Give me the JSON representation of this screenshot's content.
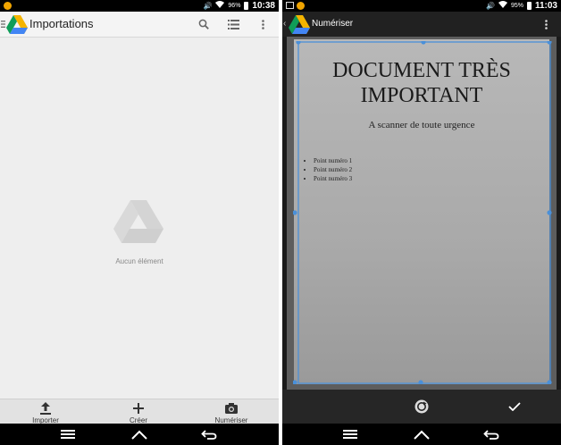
{
  "left_screen": {
    "status_bar": {
      "battery_percent": "96%",
      "time": "10:38"
    },
    "app_bar": {
      "title": "Importations",
      "icons": [
        "menu-icon",
        "google-drive-logo",
        "search-icon",
        "list-view-icon",
        "overflow-menu-icon"
      ]
    },
    "empty_state": {
      "text": "Aucun élément"
    },
    "bottom_actions": [
      {
        "label": "Importer",
        "icon": "upload-icon"
      },
      {
        "label": "Créer",
        "icon": "plus-icon"
      },
      {
        "label": "Numériser",
        "icon": "camera-icon"
      }
    ],
    "nav_bar": [
      "menu-nav-icon",
      "home-nav-icon",
      "back-nav-icon"
    ]
  },
  "right_screen": {
    "status_bar": {
      "battery_percent": "95%",
      "time": "11:03"
    },
    "app_bar": {
      "title": "Numériser",
      "icons": [
        "back-chevron-icon",
        "google-drive-logo",
        "overflow-menu-icon"
      ]
    },
    "document": {
      "title_line1": "DOCUMENT TRÈS",
      "title_line2": "IMPORTANT",
      "subtitle": "A scanner de toute urgence",
      "list": [
        "Point numéro 1",
        "Point numéro 2",
        "Point numéro 3"
      ]
    },
    "bottom_actions": [
      {
        "name": "retake",
        "icon": "retake-icon"
      },
      {
        "name": "confirm",
        "icon": "checkmark-icon"
      }
    ],
    "nav_bar": [
      "menu-nav-icon",
      "home-nav-icon",
      "back-nav-icon"
    ]
  },
  "colors": {
    "accent_blue": "#4a90d9",
    "drive_green": "#0f9d58",
    "drive_yellow": "#f4b400",
    "drive_blue": "#4285f4"
  }
}
